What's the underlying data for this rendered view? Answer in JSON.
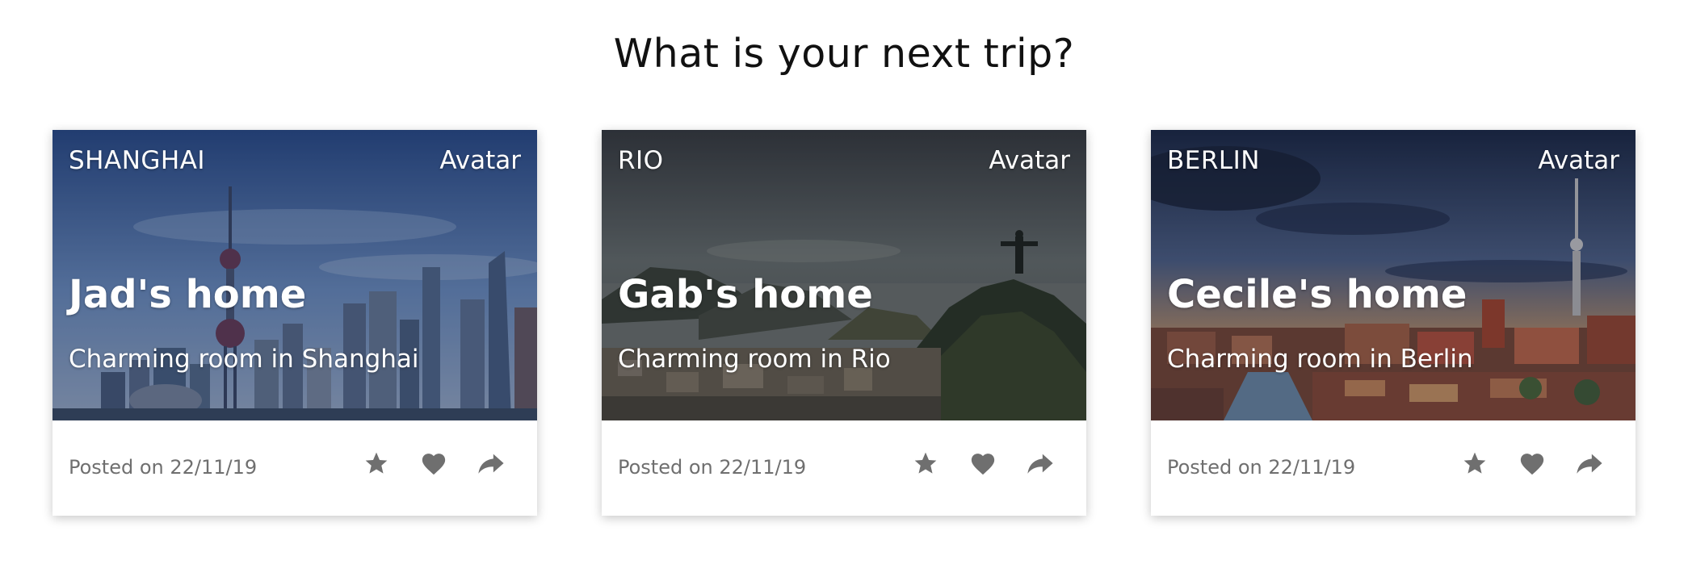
{
  "page": {
    "title": "What is your next trip?"
  },
  "colors": {
    "icon": "#6f6f6f",
    "footer_text": "#6f6f6f",
    "overlay_text": "#ffffff"
  },
  "cards": [
    {
      "city": "SHANGHAI",
      "avatar": "Avatar",
      "title": "Jad's home",
      "subtitle": "Charming room in Shanghai",
      "posted": "Posted on 22/11/19",
      "actions": [
        "star-icon",
        "heart-icon",
        "share-icon"
      ]
    },
    {
      "city": "RIO",
      "avatar": "Avatar",
      "title": "Gab's home",
      "subtitle": "Charming room in Rio",
      "posted": "Posted on 22/11/19",
      "actions": [
        "star-icon",
        "heart-icon",
        "share-icon"
      ]
    },
    {
      "city": "BERLIN",
      "avatar": "Avatar",
      "title": "Cecile's home",
      "subtitle": "Charming room in Berlin",
      "posted": "Posted on 22/11/19",
      "actions": [
        "star-icon",
        "heart-icon",
        "share-icon"
      ]
    }
  ]
}
